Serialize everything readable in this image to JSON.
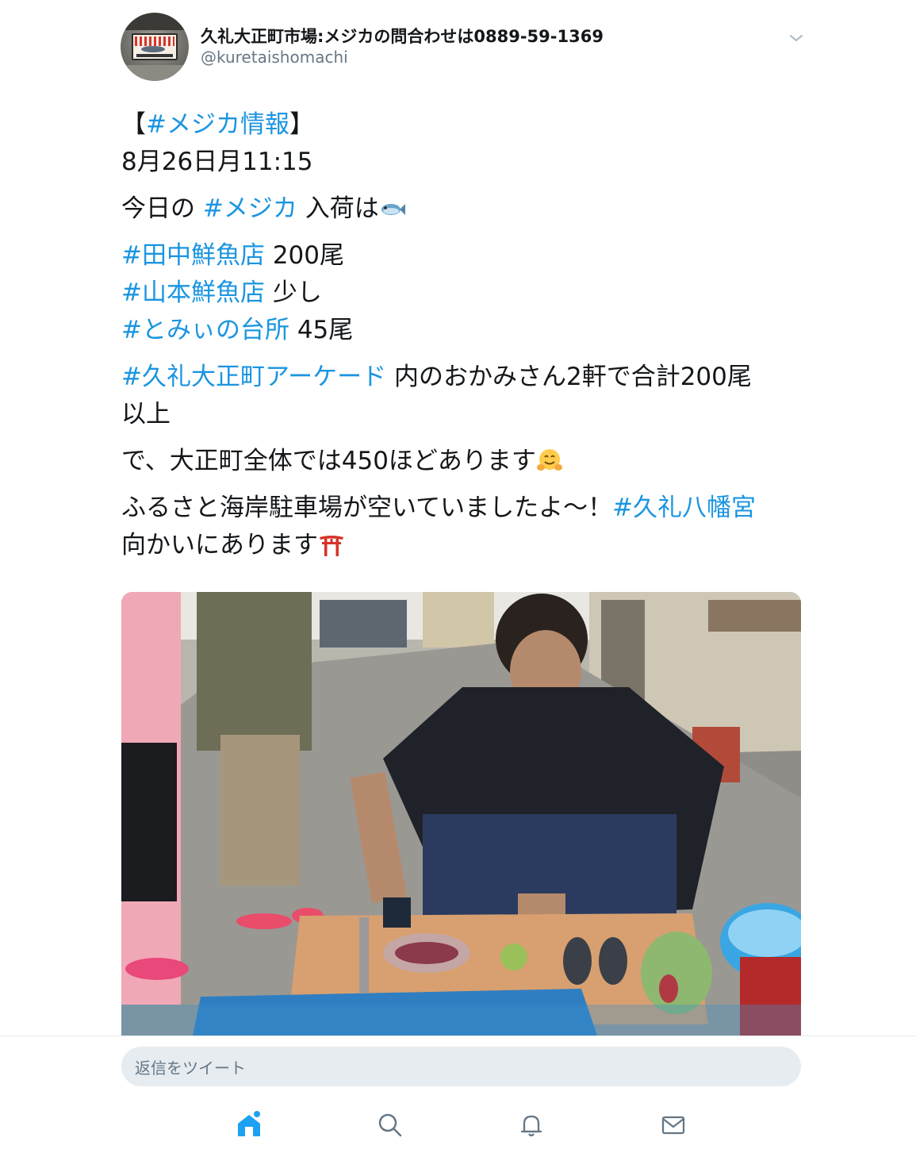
{
  "tweet": {
    "author_name": "久礼大正町市場:メジカの問合わせは0889-59-1369",
    "author_handle": "@kuretaishomachi",
    "lines": {
      "l1_open": "【",
      "l1_tag": "#メジカ情報",
      "l1_close": "】",
      "l2": "8月26日月11:15",
      "l3_a": "今日の ",
      "l3_tag": "#メジカ",
      "l3_b": " 入荷は",
      "l4_tag": "#田中鮮魚店",
      "l4_b": " 200尾",
      "l5_tag": "#山本鮮魚店",
      "l5_b": " 少し",
      "l6_tag": "#とみぃの台所",
      "l6_b": " 45尾",
      "l7_tag": "#久礼大正町アーケード",
      "l7_b": " 内のおかみさん2軒で合計200尾",
      "l8": "以上",
      "l9": "で、大正町全体では450ほどあります",
      "l10_a": "ふるさと海岸駐車場が空いていましたよ〜！",
      "l10_tag": "#久礼八幡宮",
      "l11": "向かいにあります"
    },
    "emojis": [
      "fish-emoji",
      "hugging-face-emoji",
      "torii-emoji"
    ]
  },
  "reply": {
    "placeholder": "返信をツイート"
  },
  "tabs": [
    {
      "name": "home",
      "icon": "home-icon",
      "active": true
    },
    {
      "name": "search",
      "icon": "search-icon",
      "active": false
    },
    {
      "name": "notifications",
      "icon": "bell-icon",
      "active": false
    },
    {
      "name": "messages",
      "icon": "envelope-icon",
      "active": false
    }
  ],
  "colors": {
    "link": "#1b95e0",
    "text": "#14171a",
    "secondary": "#657786",
    "reply_bg": "#e6ecf0",
    "active_tab": "#1da1f2"
  }
}
